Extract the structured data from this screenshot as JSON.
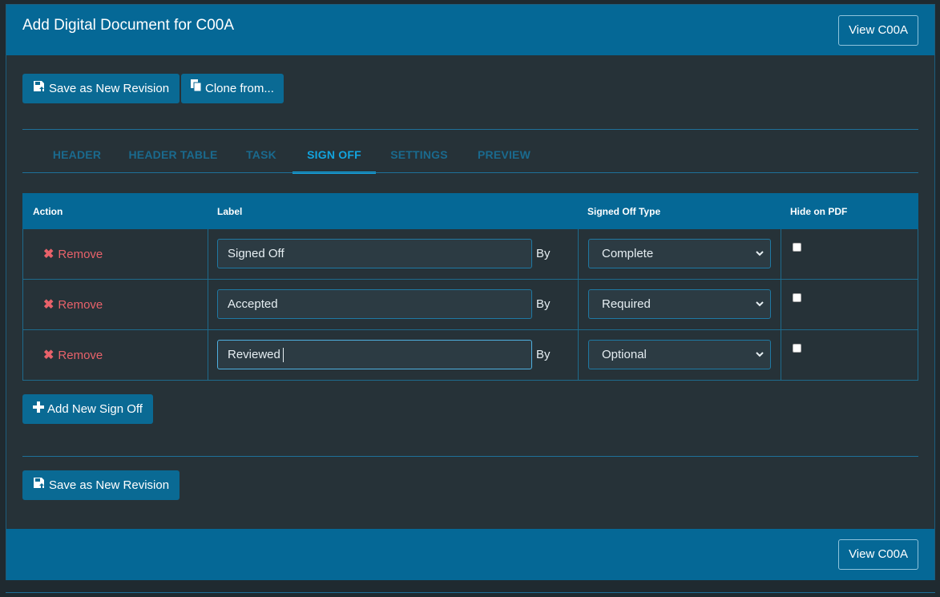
{
  "header": {
    "title": "Add Digital Document for C00A",
    "view_button": "View C00A"
  },
  "toolbar": {
    "save_revision": "Save as New Revision",
    "clone_from": "Clone from..."
  },
  "tabs": [
    {
      "label": "HEADER",
      "active": false
    },
    {
      "label": "HEADER TABLE",
      "active": false
    },
    {
      "label": "TASK",
      "active": false
    },
    {
      "label": "SIGN OFF",
      "active": true
    },
    {
      "label": "SETTINGS",
      "active": false
    },
    {
      "label": "PREVIEW",
      "active": false
    }
  ],
  "table": {
    "columns": [
      "Action",
      "Label",
      "Signed Off Type",
      "Hide on PDF"
    ],
    "rows": [
      {
        "action": "Remove",
        "label": "Signed Off",
        "by": "By",
        "type": "Complete",
        "hide_on_pdf": false
      },
      {
        "action": "Remove",
        "label": "Accepted",
        "by": "By",
        "type": "Required",
        "hide_on_pdf": false
      },
      {
        "action": "Remove",
        "label": "Reviewed",
        "by": "By",
        "type": "Optional",
        "hide_on_pdf": false
      }
    ]
  },
  "add_sign_off": "Add New Sign Off",
  "bottom_save": "Save as New Revision",
  "footer": {
    "view_button": "View C00A"
  },
  "icons": {
    "save": "save-upload-icon",
    "clone": "copy-icon",
    "remove": "times-icon",
    "add": "plus-icon",
    "select": "chevron-down-icon"
  },
  "colors": {
    "primary": "#056896",
    "background": "#263238",
    "tab_active": "#12a4df",
    "remove": "#e8626a"
  }
}
